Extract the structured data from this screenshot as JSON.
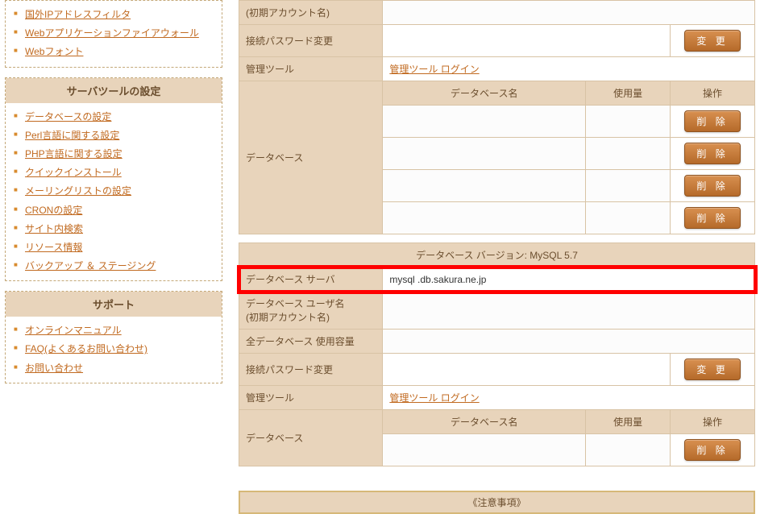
{
  "sidebar": {
    "top_items": [
      "国外IPアドレスフィルタ",
      "Webアプリケーションファイアウォール",
      "Webフォント"
    ],
    "tools_header": "サーバツールの設定",
    "tools_items": [
      "データベースの設定",
      "Perl言語に関する設定",
      "PHP言語に関する設定",
      "クイックインストール",
      "メーリングリストの設定",
      "CRONの設定",
      "サイト内検索",
      "リソース情報",
      "バックアップ ＆ ステージング"
    ],
    "support_header": "サポート",
    "support_items": [
      "オンラインマニュアル",
      "FAQ(よくあるお問い合わせ)",
      "お問い合わせ"
    ]
  },
  "table1": {
    "account_label": "(初期アカウント名)",
    "pw_label": "接続パスワード変更",
    "change_btn": "変 更",
    "mgmt_label": "管理ツール",
    "mgmt_link": "管理ツール ログイン",
    "db_label": "データベース",
    "headers": {
      "name": "データベース名",
      "usage": "使用量",
      "op": "操作"
    },
    "delete_btn": "削 除"
  },
  "table2": {
    "version_header": "データベース バージョン: MySQL 5.7",
    "server_label": "データベース サーバ",
    "server_value": "mysql    .db.sakura.ne.jp",
    "user_label_1": "データベース ユーザ名",
    "user_label_2": "(初期アカウント名)",
    "capacity_label": "全データベース 使用容量",
    "pw_label": "接続パスワード変更",
    "change_btn": "変 更",
    "mgmt_label": "管理ツール",
    "mgmt_link": "管理ツール ログイン",
    "db_label": "データベース",
    "headers": {
      "name": "データベース名",
      "usage": "使用量",
      "op": "操作"
    },
    "delete_btn": "削 除"
  },
  "bottom": {
    "title": "《注意事項》"
  }
}
